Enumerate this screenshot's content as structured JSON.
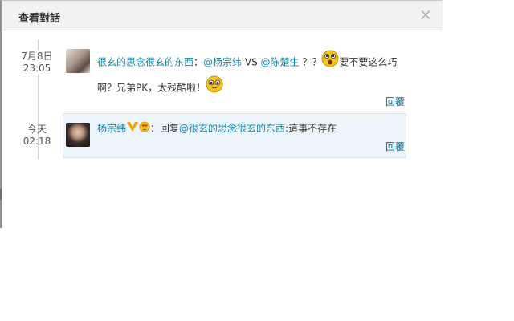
{
  "dialog": {
    "title": "查看對話",
    "close_glyph": "×"
  },
  "conversation": [
    {
      "date": "7月8日",
      "time": "23:05",
      "avatar": "avatar-photo",
      "author": "很玄的思念很玄的东西",
      "colon": "：",
      "mention1": "@杨宗纬",
      "vs": " VS ",
      "mention2": "@陈楚生",
      "q": " ？？",
      "text1": "要不要这么巧",
      "text2": "啊？兄弟PK，太残酷啦！",
      "emoji1": "surprised-face-icon",
      "emoji2": "crying-face-icon",
      "reply_label": "回覆"
    },
    {
      "date": "今天",
      "time": "02:18",
      "avatar": "avatar-photo",
      "author": "杨宗纬",
      "verified": "verified-v-badge-icon",
      "badge2": "heart-face-badge-icon",
      "colon": "：回复",
      "mention": "@很玄的思念很玄的东西",
      "text": ":這事不存在",
      "reply_label": "回覆"
    }
  ],
  "colors": {
    "link": "#0a8aa8",
    "reply_bg": "#eef4fb",
    "header_bg": "#f2f2f2"
  }
}
